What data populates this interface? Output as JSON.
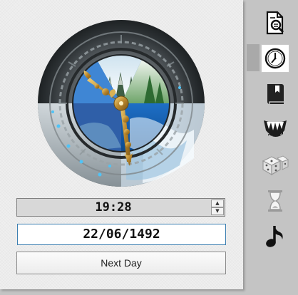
{
  "clock": {
    "time": "19:28",
    "date": "22/06/1492",
    "next_day_label": "Next Day"
  },
  "sidebar": {
    "items": [
      {
        "name": "search-document",
        "icon": "search-document-icon",
        "active": false
      },
      {
        "name": "clock",
        "icon": "clock-icon",
        "active": true
      },
      {
        "name": "book",
        "icon": "book-icon",
        "active": false
      },
      {
        "name": "monster",
        "icon": "monster-jaw-icon",
        "active": false
      },
      {
        "name": "dice",
        "icon": "dice-icon",
        "active": false
      },
      {
        "name": "hourglass",
        "icon": "hourglass-icon",
        "active": false
      },
      {
        "name": "music",
        "icon": "music-note-icon",
        "active": false
      }
    ]
  },
  "colors": {
    "ring_dark": "#3b4043",
    "ring_light": "#b9bcbc",
    "gem_blue": "#4fc3f7",
    "hand_gold": "#c9a040",
    "date_border": "#3c7fb1"
  }
}
